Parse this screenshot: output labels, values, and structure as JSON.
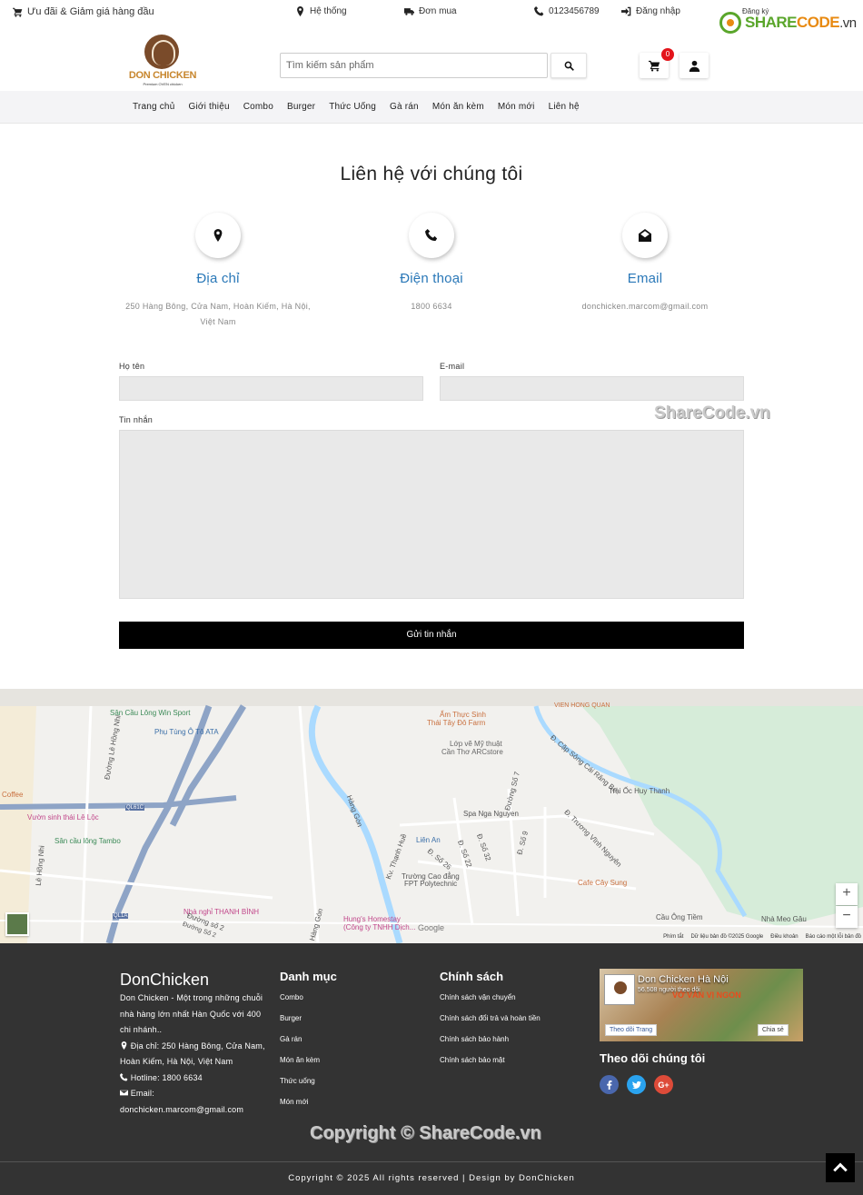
{
  "topbar": {
    "promo": "Ưu đãi & Giảm giá hàng đầu",
    "system": "Hệ thống",
    "orders": "Đơn mua",
    "phone": "0123456789",
    "login": "Đăng nhập",
    "register": "Đăng ký"
  },
  "sharecode_logo": {
    "word_green": "SHARE",
    "word_orange": "CODE",
    "suffix": ".vn"
  },
  "brand": {
    "name": "DON CHICKEN",
    "tagline": "Premium OVEN chicken"
  },
  "search": {
    "placeholder": "Tìm kiếm sản phẩm"
  },
  "cart": {
    "count": "0"
  },
  "nav": [
    "Trang chủ",
    "Giới thiệu",
    "Combo",
    "Burger",
    "Thức Uống",
    "Gà rán",
    "Món ăn kèm",
    "Món mới",
    "Liên hệ"
  ],
  "contact": {
    "title": "Liên hệ với chúng tôi",
    "address": {
      "title": "Địa chỉ",
      "line1": "250 Hàng Bông, Cửa Nam, Hoàn Kiếm, Hà Nội,",
      "line2": "Việt Nam"
    },
    "phone": {
      "title": "Điện thoại",
      "value": "1800 6634"
    },
    "email": {
      "title": "Email",
      "value": "donchicken.marcom@gmail.com"
    }
  },
  "form": {
    "name_label": "Họ tên",
    "email_label": "E-mail",
    "message_label": "Tin nhắn",
    "submit": "Gửi tin nhắn"
  },
  "watermark": {
    "small": "ShareCode.vn",
    "footer": "Copyright © ShareCode.vn"
  },
  "map": {
    "labels": [
      "Sân Cầu Lông Win Sport",
      "Phụ Tùng Ô Tô ATA",
      "Ẩm Thực Sinh",
      "Thái Tây Đô Farm",
      "Lớp vẽ Mỹ thuật",
      "Cần Thơ ARCstore",
      "VIEN HONG QUAN",
      "Trại Ốc Huy Thanh",
      "Spa Nga Nguyen",
      "Liên An",
      "Trường Cao đẳng",
      "FPT Polytechnic",
      "Cafe Cây Sung",
      "Cầu Ông Tiềm",
      "Nhà Meo Gâu",
      "Vườn sinh thái Lê Lộc",
      "Sân cầu lông Tambo",
      "Nhà nghỉ THANH BÌNH",
      "Hung's Homestay",
      "(Công ty TNHH Dịch...",
      "Coffee",
      "Đường Lê Hồng Nhi",
      "Lê Hồng Nhi",
      "Hàng Gòn",
      "Kv. Thạnh Huề",
      "Đường số 2",
      "Đường Số 7",
      "Đ. Số 26",
      "Đ. Số 32",
      "Đ. Số 22",
      "Đ. Số 9",
      "Đ. Cặp Sông Cái Răng Bé",
      "Đ. Trương Vĩnh Nguyên",
      "Hàng Gòn",
      "Đường Số 2",
      "QL61C",
      "QL1A"
    ],
    "attribution": [
      "Phím tắt",
      "Dữ liệu bản đồ ©2025 Google",
      "Điều khoản",
      "Báo cáo một lỗi bản đồ"
    ],
    "google": "Google",
    "zoom_in": "+",
    "zoom_out": "−"
  },
  "footer": {
    "brand": "DonChicken",
    "description": "Don Chicken - Một trong những chuỗi nhà hàng lớn nhất Hàn Quốc với 400 chi nhánh..",
    "address": "Địa chỉ: 250 Hàng Bông, Cửa Nam, Hoàn Kiếm, Hà Nội, Việt Nam",
    "hotline": "Hotline: 1800 6634",
    "email_label": "Email:",
    "email": "donchicken.marcom@gmail.com",
    "categories_title": "Danh mục",
    "categories": [
      "Combo",
      "Burger",
      "Gà rán",
      "Món ăn kèm",
      "Thức uống",
      "Món mới"
    ],
    "policy_title": "Chính sách",
    "policies": [
      "Chính sách vận chuyển",
      "Chính sách đổi trả và hoàn tiền",
      "Chính sách bảo hành",
      "Chính sách bảo mật"
    ],
    "fb_page": {
      "name": "Don Chicken Hà Nội",
      "followers": "56.508 người theo dõi",
      "slogan": "VỚ VÀN VỊ NGON",
      "follow": "Theo dõi Trang",
      "share": "Chia sẻ"
    },
    "follow_title": "Theo dõi chúng tôi",
    "copyright": "Copyright © 2025 All rights reserved | Design by DonChicken"
  },
  "colors": {
    "accent_blue": "#2a78b8",
    "footer_bg": "#333333",
    "badge_red": "#e3141b",
    "facebook": "#4a67ad",
    "twitter": "#2aa3ef",
    "google": "#dd4b39"
  },
  "icons": [
    "cart-icon",
    "map-marker-icon",
    "truck-icon",
    "phone-icon",
    "sign-in-icon",
    "search-icon",
    "user-icon",
    "envelope-open-icon",
    "facebook-icon",
    "twitter-icon",
    "google-plus-icon",
    "chevron-up-icon"
  ]
}
